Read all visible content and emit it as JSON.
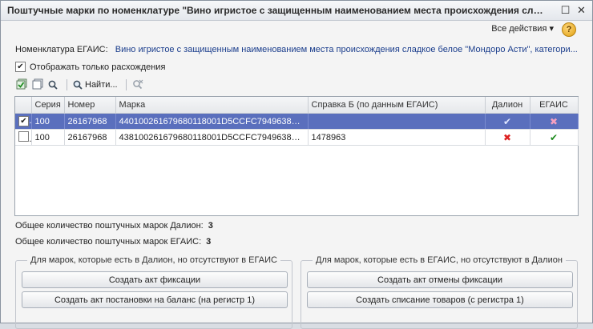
{
  "window": {
    "title": "Поштучные марки по номенклатуре \"Вино игристое с защищенным наименованием места происхождения слад..."
  },
  "actions": {
    "all_actions": "Все действия ▾",
    "help": "?"
  },
  "egais": {
    "label": "Номенклатура ЕГАИС:",
    "value": "Вино игристое с защищенным наименованием места происхождения сладкое белое \"Мондоро Асти\", категори..."
  },
  "filter": {
    "label": "Отображать только расхождения",
    "checked": true
  },
  "toolbar": {
    "find_label": "Найти..."
  },
  "table": {
    "columns": [
      "Серия",
      "Номер",
      "Марка",
      "Справка Б (по данным ЕГАИС)",
      "Далион",
      "ЕГАИС"
    ],
    "rows": [
      {
        "checked": true,
        "series": "100",
        "number": "26167968",
        "mark": "440100261679680118001D5CCFC794963898...",
        "ref_b": "",
        "dalion": "✔",
        "egais": "✖"
      },
      {
        "checked": false,
        "series": "100",
        "number": "26167968",
        "mark": "438100261679680118001D5CCFC794963898...",
        "ref_b": "1478963",
        "dalion": "✖",
        "egais": "✔"
      }
    ]
  },
  "totals": {
    "dalion_label": "Общее количество поштучных марок Далион:",
    "dalion_value": "3",
    "egais_label": "Общее количество поштучных марок ЕГАИС:",
    "egais_value": "3"
  },
  "left_group": {
    "title": "Для марок, которые есть в Далион, но отсутствуют в ЕГАИС",
    "button1": "Создать акт фиксации",
    "button2": "Создать акт постановки на баланс (на регистр 1)"
  },
  "right_group": {
    "title": "Для марок, которые есть в ЕГАИС, но отсутствуют в Далион",
    "button1": "Создать акт отмены фиксации",
    "button2": "Создать списание товаров (с регистра 1)"
  },
  "colors": {
    "selection": "#5a6fbd",
    "link_text": "#1a3d8c",
    "ok": "#1f8c1f",
    "error": "#dd2222"
  }
}
